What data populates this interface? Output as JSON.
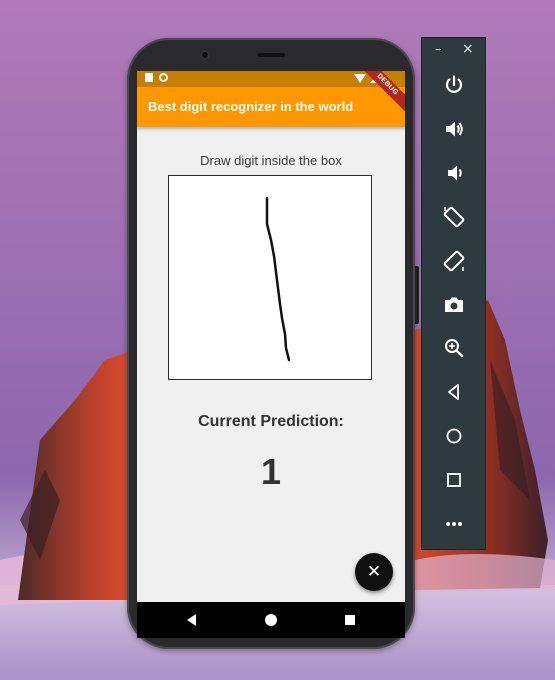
{
  "app": {
    "title": "Best digit recognizer in the world",
    "debug_banner": "DEBUG"
  },
  "main": {
    "instruction": "Draw digit inside the box",
    "prediction_label": "Current Prediction:",
    "prediction_value": "1"
  },
  "fab": {
    "icon": "close-icon",
    "glyph": "✕"
  },
  "colors": {
    "app_bar": "#ff9800",
    "status_bar": "#c67f00",
    "debug_banner": "#b3261e",
    "emulator_toolbar": "#2d3a40"
  },
  "emulator_toolbar": {
    "window_controls": {
      "minimize": "–",
      "close": "×"
    },
    "buttons": [
      {
        "name": "power",
        "icon": "power-icon"
      },
      {
        "name": "volume-up",
        "icon": "volume-up-icon"
      },
      {
        "name": "volume-down",
        "icon": "volume-down-icon"
      },
      {
        "name": "rotate-left",
        "icon": "rotate-left-icon"
      },
      {
        "name": "rotate-right",
        "icon": "rotate-right-icon"
      },
      {
        "name": "screenshot",
        "icon": "camera-icon"
      },
      {
        "name": "zoom",
        "icon": "zoom-icon"
      },
      {
        "name": "back",
        "icon": "back-triangle-icon"
      },
      {
        "name": "home",
        "icon": "home-circle-icon"
      },
      {
        "name": "overview",
        "icon": "overview-square-icon"
      },
      {
        "name": "more",
        "icon": "more-dots-icon"
      }
    ]
  },
  "navigation_bar": {
    "buttons": [
      "back-icon",
      "home-icon",
      "recents-icon"
    ]
  }
}
